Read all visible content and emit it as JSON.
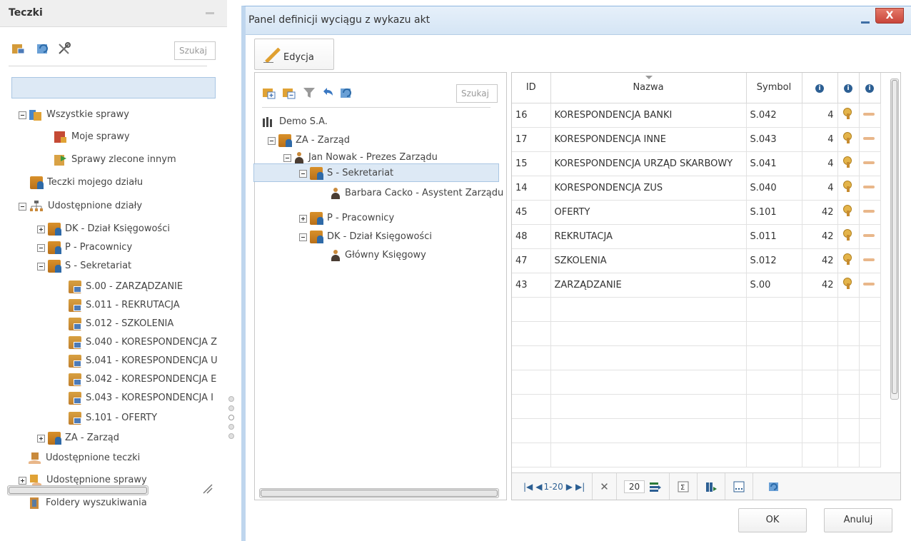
{
  "left_panel": {
    "title": "Teczki",
    "search_placeholder": "Szukaj",
    "tree": [
      {
        "label": "Wszystkie sprawy"
      },
      {
        "label": "Moje sprawy"
      },
      {
        "label": "Sprawy zlecone innym"
      },
      {
        "label": "Teczki mojego działu"
      },
      {
        "label": "Udostępnione działy"
      },
      {
        "label": "DK - Dział Księgowości"
      },
      {
        "label": "P - Pracownicy"
      },
      {
        "label": "S - Sekretariat"
      },
      {
        "label": "S.00 - ZARZĄDZANIE"
      },
      {
        "label": "S.011 - REKRUTACJA"
      },
      {
        "label": "S.012 - SZKOLENIA"
      },
      {
        "label": "S.040 - KORESPONDENCJA Z"
      },
      {
        "label": "S.041 - KORESPONDENCJA U"
      },
      {
        "label": "S.042 - KORESPONDENCJA E"
      },
      {
        "label": "S.043 - KORESPONDENCJA I"
      },
      {
        "label": "S.101 - OFERTY"
      },
      {
        "label": "ZA - Zarząd"
      },
      {
        "label": "Udostępnione teczki"
      },
      {
        "label": "Udostępnione sprawy"
      },
      {
        "label": "Foldery wyszukiwania"
      }
    ]
  },
  "dialog": {
    "title": "Panel definicji wyciągu z wykazu akt",
    "close_label": "X",
    "edit_label": "Edycja",
    "mid_search_placeholder": "Szukaj",
    "org_tree": [
      {
        "label": "Demo S.A."
      },
      {
        "label": "ZA - Zarząd"
      },
      {
        "label": "Jan Nowak - Prezes Zarządu"
      },
      {
        "label": "S - Sekretariat"
      },
      {
        "label": "Barbara Cacko - Asystent Zarządu"
      },
      {
        "label": "P - Pracownicy"
      },
      {
        "label": "DK - Dział Księgowości"
      },
      {
        "label": "Główny Księgowy"
      }
    ],
    "grid": {
      "columns": [
        "ID",
        "Nazwa",
        "Symbol"
      ],
      "info_glyph": "i",
      "rows": [
        {
          "id": "16",
          "nazwa": "KORESPONDENCJA BANKI",
          "symbol": "S.042",
          "n": "4"
        },
        {
          "id": "17",
          "nazwa": "KORESPONDENCJA INNE",
          "symbol": "S.043",
          "n": "4"
        },
        {
          "id": "15",
          "nazwa": "KORESPONDENCJA URZĄD SKARBOWY",
          "symbol": "S.041",
          "n": "4"
        },
        {
          "id": "14",
          "nazwa": "KORESPONDENCJA ZUS",
          "symbol": "S.040",
          "n": "4"
        },
        {
          "id": "45",
          "nazwa": "OFERTY",
          "symbol": "S.101",
          "n": "42"
        },
        {
          "id": "48",
          "nazwa": "REKRUTACJA",
          "symbol": "S.011",
          "n": "42"
        },
        {
          "id": "47",
          "nazwa": "SZKOLENIA",
          "symbol": "S.012",
          "n": "42"
        },
        {
          "id": "43",
          "nazwa": "ZARZĄDZANIE",
          "symbol": "S.00",
          "n": "42"
        }
      ],
      "pager": {
        "range": "1-20",
        "page_size": "20"
      }
    },
    "ok_label": "OK",
    "cancel_label": "Anuluj"
  }
}
